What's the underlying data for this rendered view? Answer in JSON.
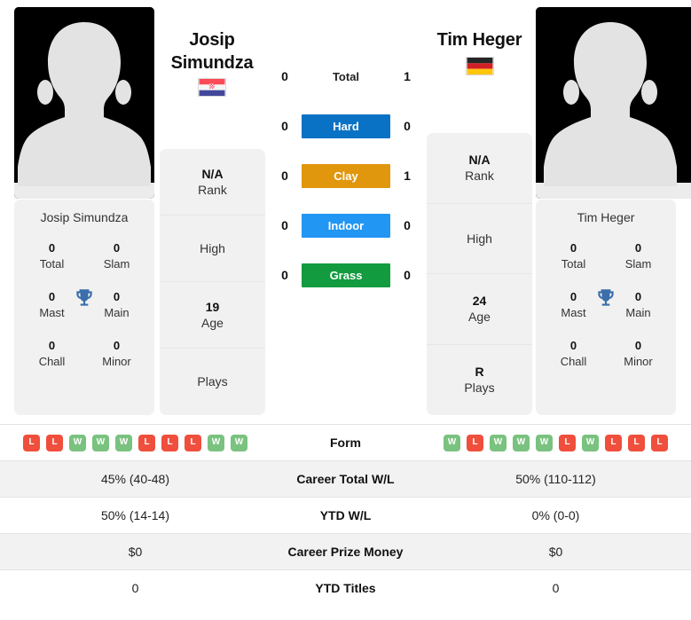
{
  "players": {
    "left": {
      "name": "Josip Simundza",
      "name_line1": "Josip",
      "name_line2": "Simundza",
      "country": "Croatia",
      "flag_icon": "croatia-flag-icon",
      "avatar_icon": "player-placeholder-avatar-icon",
      "info": {
        "rank_value": "N/A",
        "rank_label": "Rank",
        "high_value": "",
        "high_label": "High",
        "age_value": "19",
        "age_label": "Age",
        "plays_value": "",
        "plays_label": "Plays"
      },
      "titles": {
        "card_name": "Josip Simundza",
        "trophy_icon": "trophy-icon",
        "total_value": "0",
        "total_label": "Total",
        "slam_value": "0",
        "slam_label": "Slam",
        "mast_value": "0",
        "mast_label": "Mast",
        "main_value": "0",
        "main_label": "Main",
        "chall_value": "0",
        "chall_label": "Chall",
        "minor_value": "0",
        "minor_label": "Minor"
      },
      "form": [
        "L",
        "L",
        "W",
        "W",
        "W",
        "L",
        "L",
        "L",
        "W",
        "W"
      ],
      "career_total_wl": "45% (40-48)",
      "ytd_wl": "50% (14-14)",
      "career_prize_money": "$0",
      "ytd_titles": "0"
    },
    "right": {
      "name": "Tim Heger",
      "name_line1": "Tim Heger",
      "name_line2": "",
      "country": "Germany",
      "flag_icon": "germany-flag-icon",
      "avatar_icon": "player-placeholder-avatar-icon",
      "info": {
        "rank_value": "N/A",
        "rank_label": "Rank",
        "high_value": "",
        "high_label": "High",
        "age_value": "24",
        "age_label": "Age",
        "plays_value": "R",
        "plays_label": "Plays"
      },
      "titles": {
        "card_name": "Tim Heger",
        "trophy_icon": "trophy-icon",
        "total_value": "0",
        "total_label": "Total",
        "slam_value": "0",
        "slam_label": "Slam",
        "mast_value": "0",
        "mast_label": "Mast",
        "main_value": "0",
        "main_label": "Main",
        "chall_value": "0",
        "chall_label": "Chall",
        "minor_value": "0",
        "minor_label": "Minor"
      },
      "form": [
        "W",
        "L",
        "W",
        "W",
        "W",
        "L",
        "W",
        "L",
        "L",
        "L"
      ],
      "career_total_wl": "50% (110-112)",
      "ytd_wl": "0% (0-0)",
      "career_prize_money": "$0",
      "ytd_titles": "0"
    }
  },
  "head_to_head": [
    {
      "label": "Total",
      "left": "0",
      "right": "1",
      "style": "plain",
      "color": ""
    },
    {
      "label": "Hard",
      "left": "0",
      "right": "0",
      "style": "surface",
      "color": "#0a72c4"
    },
    {
      "label": "Clay",
      "left": "0",
      "right": "1",
      "style": "surface",
      "color": "#e0970d"
    },
    {
      "label": "Indoor",
      "left": "0",
      "right": "0",
      "style": "surface",
      "color": "#2196f3"
    },
    {
      "label": "Grass",
      "left": "0",
      "right": "0",
      "style": "surface",
      "color": "#129b3f"
    }
  ],
  "comparison_rows": [
    {
      "label": "Form",
      "type": "form",
      "left": "",
      "right": ""
    },
    {
      "label": "Career Total W/L",
      "type": "text",
      "left": "45% (40-48)",
      "right": "50% (110-112)"
    },
    {
      "label": "YTD W/L",
      "type": "text",
      "left": "50% (14-14)",
      "right": "0% (0-0)"
    },
    {
      "label": "Career Prize Money",
      "type": "text",
      "left": "$0",
      "right": "$0"
    },
    {
      "label": "YTD Titles",
      "type": "text",
      "left": "0",
      "right": "0"
    }
  ],
  "colors": {
    "hard": "#0a72c4",
    "clay": "#e0970d",
    "indoor": "#2196f3",
    "grass": "#129b3f",
    "win_badge": "#7ac27f",
    "loss_badge": "#ef4f3c",
    "card_bg": "#f1f1f1",
    "row_shade": "#f2f2f2"
  }
}
